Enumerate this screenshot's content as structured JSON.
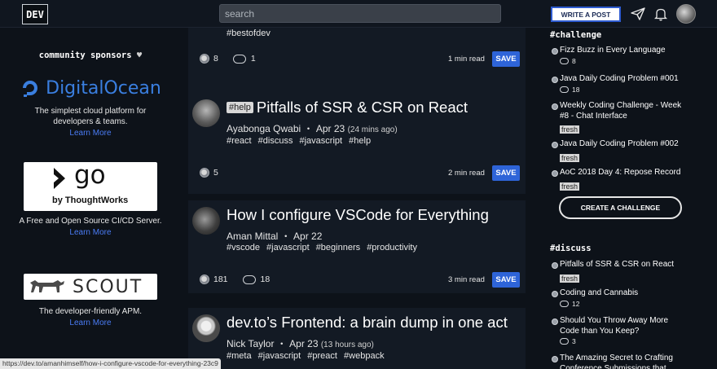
{
  "header": {
    "logo": "DEV",
    "search_placeholder": "search",
    "write_button": "WRITE A POST"
  },
  "sponsors": {
    "title": "community sponsors",
    "items": [
      {
        "name": "DigitalOcean",
        "description": "The simplest cloud platform for developers & teams.",
        "link": "Learn More"
      },
      {
        "name": "go by ThoughtWorks",
        "logo_main": "go",
        "logo_sub": "by ThoughtWorks",
        "description": "A Free and Open Source CI/CD Server.",
        "link": "Learn More"
      },
      {
        "name": "SCOUT",
        "logo_text": "SCOUT",
        "description": "The developer-friendly APM.",
        "link": "Learn More"
      }
    ]
  },
  "feed": {
    "posts": [
      {
        "tags": [
          "#bestofdev"
        ],
        "reactions": "8",
        "comments": "1",
        "read_time": "1 min read",
        "save": "SAVE"
      },
      {
        "flag": "#help",
        "title": "Pitfalls of SSR & CSR on React",
        "author": "Ayabonga Qwabi",
        "date": "Apr 23",
        "ago": "(24 mins ago)",
        "tags": [
          "#react",
          "#discuss",
          "#javascript",
          "#help"
        ],
        "reactions": "5",
        "read_time": "2 min read",
        "save": "SAVE"
      },
      {
        "title": "How I configure VSCode for Everything",
        "author": "Aman Mittal",
        "date": "Apr 22",
        "tags": [
          "#vscode",
          "#javascript",
          "#beginners",
          "#productivity"
        ],
        "reactions": "181",
        "comments": "18",
        "read_time": "3 min read",
        "save": "SAVE"
      },
      {
        "title": "dev.to’s Frontend: a brain dump in one act",
        "author": "Nick Taylor",
        "date": "Apr 23",
        "ago": "(13 hours ago)",
        "tags": [
          "#meta",
          "#javascript",
          "#preact",
          "#webpack"
        ]
      }
    ]
  },
  "right": {
    "challenge": {
      "heading": "#challenge",
      "items": [
        {
          "title": "Fizz Buzz in Every Language",
          "comments": "8"
        },
        {
          "title": "Java Daily Coding Problem #001",
          "comments": "18"
        },
        {
          "title": "Weekly Coding Challenge - Week #8 - Chat Interface",
          "badge": "fresh"
        },
        {
          "title": "Java Daily Coding Problem #002",
          "badge": "fresh"
        },
        {
          "title": "AoC 2018 Day 4: Repose Record",
          "badge": "fresh"
        }
      ],
      "button": "CREATE A CHALLENGE"
    },
    "discuss": {
      "heading": "#discuss",
      "items": [
        {
          "title": "Pitfalls of SSR & CSR on React",
          "badge": "fresh"
        },
        {
          "title": "Coding and Cannabis",
          "comments": "12"
        },
        {
          "title": "Should You Throw Away More Code than You Keep?",
          "comments": "3"
        },
        {
          "title": "The Amazing Secret to Crafting Conference Submissions that"
        }
      ]
    }
  },
  "status_url": "https://dev.to/amanhimself/how-i-configure-vscode-for-everything-23c9"
}
